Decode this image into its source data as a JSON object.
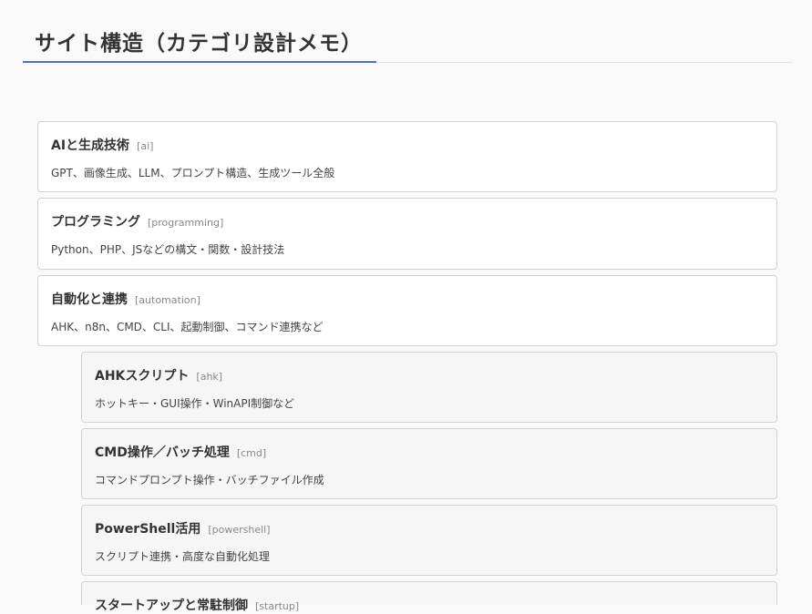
{
  "page": {
    "title": "サイト構造（カテゴリ設計メモ）"
  },
  "categories": [
    {
      "name": "AIと生成技術",
      "slug": "[ai]",
      "description": "GPT、画像生成、LLM、プロンプト構造、生成ツール全般"
    },
    {
      "name": "プログラミング",
      "slug": "[programming]",
      "description": "Python、PHP、JSなどの構文・関数・設計技法"
    },
    {
      "name": "自動化と連携",
      "slug": "[automation]",
      "description": "AHK、n8n、CMD、CLI、起動制御、コマンド連携など"
    }
  ],
  "subcategories": [
    {
      "name": "AHKスクリプト",
      "slug": "[ahk]",
      "description": "ホットキー・GUI操作・WinAPI制御など"
    },
    {
      "name": "CMD操作／バッチ処理",
      "slug": "[cmd]",
      "description": "コマンドプロンプト操作・バッチファイル作成"
    },
    {
      "name": "PowerShell活用",
      "slug": "[powershell]",
      "description": "スクリプト連携・高度な自動化処理"
    },
    {
      "name": "スタートアップと常駐制御",
      "slug": "[startup]",
      "description": ""
    }
  ]
}
